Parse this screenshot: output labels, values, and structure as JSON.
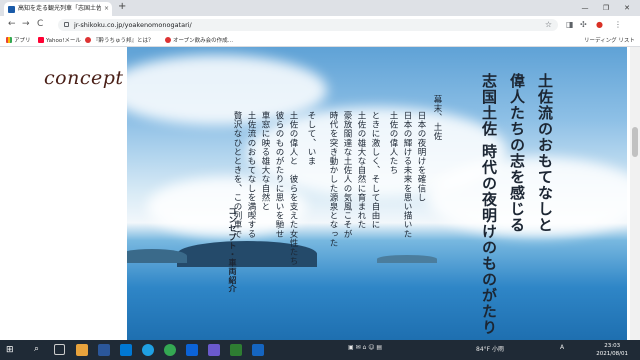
{
  "browser": {
    "tab_title": "高知を走る観光列車「志国土佐 時…",
    "tab_close": "×",
    "new_tab": "+",
    "url": "jr-shikoku.co.jp/yoakenomonogatari/",
    "window_min": "—",
    "window_max": "❐",
    "window_close": "✕",
    "back": "←",
    "forward": "→",
    "reload": "C",
    "star": "☆"
  },
  "bookmarks": {
    "apps": "アプリ",
    "yahoo": "Yahoo!メール",
    "item2": "『酔うちゅう邦』とは？",
    "item3": "オープン飲み会の作成…",
    "reading_list": "リーディング リスト"
  },
  "page": {
    "concept_logo": "concept",
    "headline_1": "土佐流のおもてなしと",
    "headline_2": "偉人たちの志を感じる",
    "headline_3": "志国土佐 時代の夜明けのものがたり",
    "body_lines": [
      "幕末、土佐",
      "日本の夜明けを確信し",
      "日本の輝ける未来を思い描いた",
      "土佐の偉人たち",
      "ときに激しく、そして自由に",
      "土佐の雄大な自然に育まれた",
      "豪放闊達な土佐人の気風こそが",
      "時代を突き動かした源泉となった",
      "そして、いま",
      "土佐の偉人と　彼らを支えた女性たち",
      "彼らのものがたりに思いを馳せ",
      "車窓に映る雄大な自然と",
      "土佐流のおもてなしを満喫する",
      "贅沢なひとときを、この列車で"
    ],
    "link_label": "コンセプト・車両紹介"
  },
  "taskbar": {
    "weather": "84°F 小雨",
    "ime": "A",
    "time": "23:03",
    "date": "2021/08/01"
  },
  "colors": {
    "headline": "#1c2633",
    "logo": "#4a2018",
    "taskbar": "#1f2a36"
  }
}
